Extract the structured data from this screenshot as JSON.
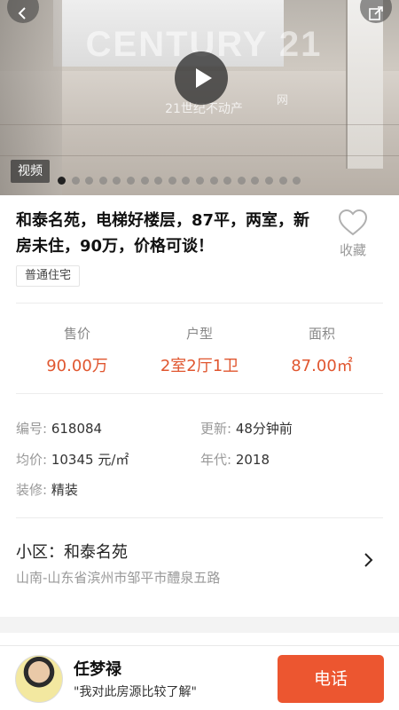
{
  "hero": {
    "watermark": "CENTURY 21",
    "watermark_sub": "21世纪不动产",
    "watermark_net": "网",
    "video_label": "视频",
    "dot_count": 18,
    "active_dot": 0
  },
  "listing": {
    "title": "和泰名苑，电梯好楼层，87平，两室，新房未住，90万，价格可谈！",
    "favorite_label": "收藏",
    "tag": "普通住宅"
  },
  "metrics": [
    {
      "label": "售价",
      "value": "90.00万"
    },
    {
      "label": "户型",
      "value": "2室2厅1卫"
    },
    {
      "label": "面积",
      "value": "87.00㎡"
    }
  ],
  "details": {
    "id_label": "编号:",
    "id_value": "618084",
    "updated_label": "更新:",
    "updated_value": "48分钟前",
    "unit_price_label": "均价:",
    "unit_price_value": "10345 元/㎡",
    "year_label": "年代:",
    "year_value": "2018",
    "decor_label": "装修:",
    "decor_value": "精装"
  },
  "community": {
    "name": "小区：和泰名苑",
    "address": "山南-山东省滨州市邹平市醴泉五路"
  },
  "agent": {
    "name": "任梦禄",
    "quote": "\"我对此房源比较了解\"",
    "call_label": "电话"
  },
  "colors": {
    "accent": "#ec5630",
    "metric_value": "#e0562f"
  },
  "icons": [
    "back-icon",
    "share-icon",
    "play-icon",
    "heart-icon",
    "chevron-right-icon"
  ]
}
